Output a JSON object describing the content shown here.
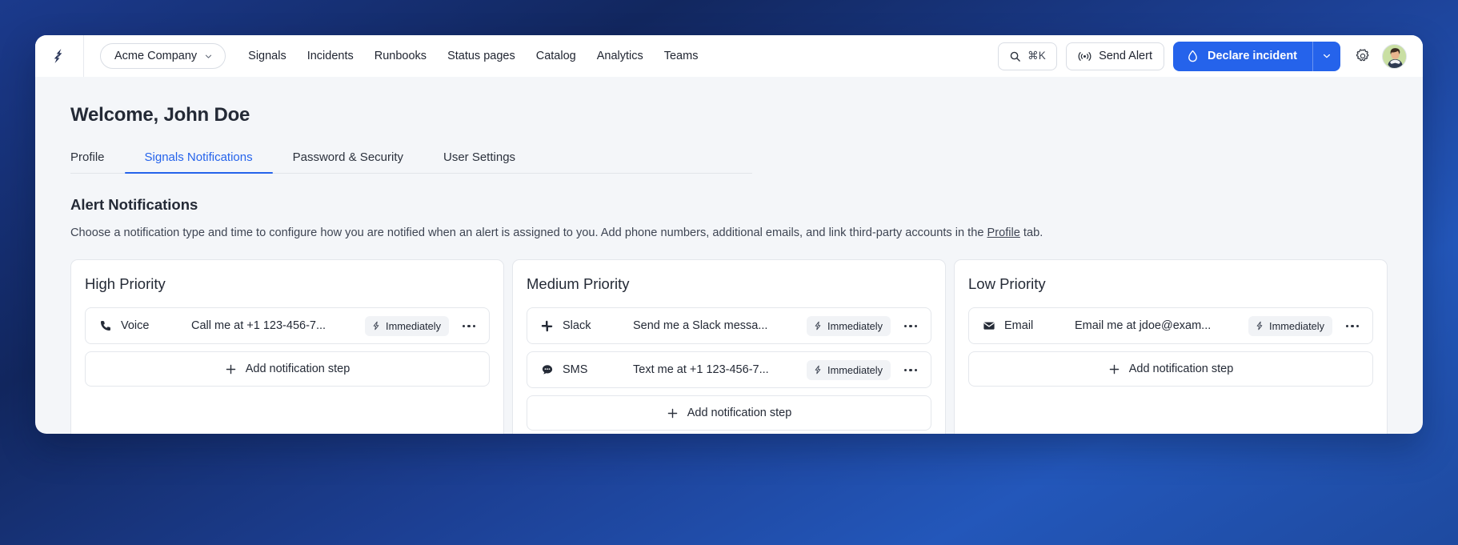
{
  "topbar": {
    "logo_icon": "signals-logo-icon",
    "org_switcher": {
      "label": "Acme Company",
      "icon": "chevron-down-icon"
    },
    "nav_links": [
      {
        "label": "Signals"
      },
      {
        "label": "Incidents"
      },
      {
        "label": "Runbooks"
      },
      {
        "label": "Status pages"
      },
      {
        "label": "Catalog"
      },
      {
        "label": "Analytics"
      },
      {
        "label": "Teams"
      }
    ],
    "search": {
      "icon": "search-icon",
      "shortcut": "⌘K"
    },
    "send_alert": {
      "label": "Send Alert",
      "icon": "broadcast-icon"
    },
    "declare_incident": {
      "label": "Declare incident",
      "icon": "droplet-icon",
      "caret_icon": "chevron-down-icon",
      "accent_color": "#2563eb"
    },
    "settings": {
      "icon": "gear-icon"
    },
    "avatar": {
      "icon": "avatar",
      "alt": "John Doe"
    }
  },
  "page": {
    "title": "Welcome, John Doe",
    "tabs": [
      {
        "label": "Profile",
        "active": false
      },
      {
        "label": "Signals Notifications",
        "active": true
      },
      {
        "label": "Password & Security",
        "active": false
      },
      {
        "label": "User Settings",
        "active": false
      }
    ],
    "section": {
      "title": "Alert Notifications",
      "description_before": "Choose a notification type and time to configure how you are notified when an alert is assigned to you. Add phone numbers, additional emails, and link third-party accounts in the ",
      "description_link": "Profile",
      "description_after": " tab."
    },
    "add_step_label": "Add notification step",
    "add_step_icon": "plus-icon",
    "kebab_icon": "more-horizontal-icon",
    "cards": [
      {
        "title": "High Priority",
        "steps": [
          {
            "channel": "Voice",
            "channel_icon": "phone-icon",
            "detail": "Call me at +1 123-456-7...",
            "timing": "Immediately",
            "timing_icon": "lightning-bolt-icon"
          }
        ]
      },
      {
        "title": "Medium Priority",
        "steps": [
          {
            "channel": "Slack",
            "channel_icon": "slack-icon",
            "detail": "Send me a Slack messa...",
            "timing": "Immediately",
            "timing_icon": "lightning-bolt-icon"
          },
          {
            "channel": "SMS",
            "channel_icon": "chat-bubble-icon",
            "detail": "Text me at +1 123-456-7...",
            "timing": "Immediately",
            "timing_icon": "lightning-bolt-icon"
          }
        ]
      },
      {
        "title": "Low Priority",
        "steps": [
          {
            "channel": "Email",
            "channel_icon": "envelope-icon",
            "detail": "Email me at jdoe@exam...",
            "timing": "Immediately",
            "timing_icon": "lightning-bolt-icon"
          }
        ]
      }
    ]
  }
}
